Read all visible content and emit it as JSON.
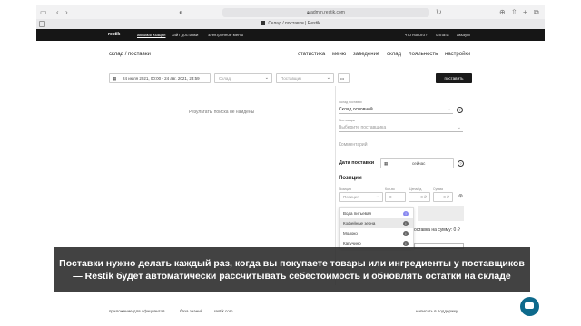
{
  "browser": {
    "url": "admin.restik.com",
    "tab_title": "Склад / поставки | Restik",
    "back_icon": "chevron-left-icon",
    "forward_icon": "chevron-right-icon"
  },
  "topbar": {
    "logo": "restik",
    "nav": [
      "автоматизация",
      "сайт доставки",
      "электронное меню"
    ],
    "right": [
      "что нового?",
      "оплата",
      "аккаунт"
    ]
  },
  "page": {
    "title": "склад / поставки",
    "subnav": [
      "статистика",
      "меню",
      "заведение",
      "склад",
      "лояльность",
      "настройки"
    ]
  },
  "filters": {
    "date_range": "24 июля 2021, 00:00 - 24 авг. 2021, 23:59",
    "warehouse_placeholder": "Склад",
    "supplier_placeholder": "Поставщик",
    "more": "•••",
    "supply_button": "поставить"
  },
  "empty_state": "Результаты поиска не найдены",
  "form": {
    "warehouse_label": "Склад поставки",
    "warehouse_value": "Склад основной",
    "supplier_label": "Поставщик",
    "supplier_placeholder": "Выберите поставщика",
    "comment_placeholder": "Комментарий",
    "date_label": "Дата поставки",
    "date_value": "сейчас",
    "positions_title": "Позиции",
    "col_position": "Позиция",
    "col_qty": "Кол-во",
    "col_price": "Цена/ед.",
    "col_sum": "Сумма",
    "position_placeholder": "Позиция",
    "qty_value": "0",
    "price_value": "0 ₽",
    "sum_value": "0 ₽",
    "total_text": "оставка на сумму: 0 ₽",
    "dropdown_items": [
      "Вода питьевая",
      "Кофейные зерна",
      "Молоко",
      "Капучино"
    ]
  },
  "caption": [
    "Поставки нужно делать каждый раз, когда вы покупаете товары или ингредиенты у поставщиков",
    "— Restik будет автоматически рассчитывать себестоимость и обновлять остатки на складе"
  ],
  "footer": {
    "links": [
      "приложение для официантов",
      "база знаний",
      "restik.com"
    ],
    "contact": "написать в поддержку"
  }
}
